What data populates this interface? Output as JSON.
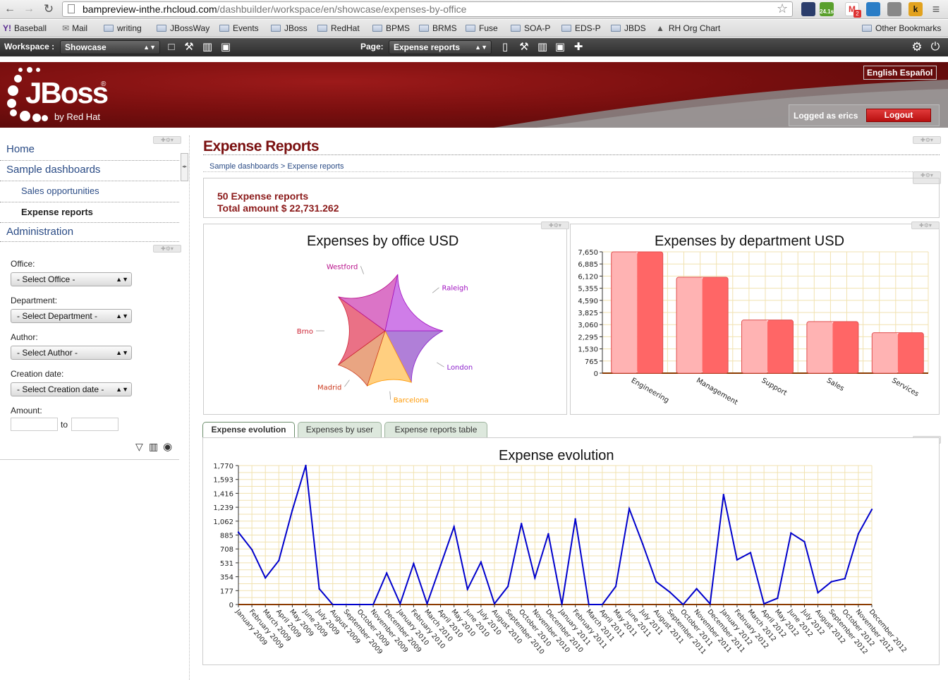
{
  "browser": {
    "url_host": "bampreview-inthe.rhcloud.com",
    "url_path": "/dashbuilder/workspace/en/showcase/expenses-by-office",
    "ext_badges": [
      "24.1s",
      "2"
    ],
    "bookmarks": [
      "Baseball",
      "Mail",
      "writing",
      "JBossWay",
      "Events",
      "JBoss",
      "RedHat",
      "BPMS",
      "BRMS",
      "Fuse",
      "SOA-P",
      "EDS-P",
      "JBDS",
      "RH Org Chart"
    ],
    "other_bookmarks": "Other Bookmarks"
  },
  "workspace_bar": {
    "workspace_label": "Workspace :",
    "workspace_value": "Showcase",
    "page_label": "Page:",
    "page_value": "Expense reports"
  },
  "header": {
    "logo_text": "JBoss",
    "logo_sub": "by Red Hat",
    "lang_english": "English",
    "lang_espanol": "Español",
    "logged_as": "Logged as erics",
    "logout": "Logout"
  },
  "sidebar": {
    "nav": [
      {
        "label": "Home",
        "level": 1
      },
      {
        "label": "Sample dashboards",
        "level": 1
      },
      {
        "label": "Sales opportunities",
        "level": 2
      },
      {
        "label": "Expense reports",
        "level": 2,
        "active": true
      },
      {
        "label": "Administration",
        "level": 1
      }
    ],
    "filters": {
      "office_label": "Office:",
      "office_value": "- Select Office -",
      "department_label": "Department:",
      "department_value": "- Select Department -",
      "author_label": "Author:",
      "author_value": "- Select Author -",
      "date_label": "Creation date:",
      "date_value": "- Select Creation date -",
      "amount_label": "Amount:",
      "amount_to": "to"
    }
  },
  "main": {
    "title": "Expense Reports",
    "breadcrumb": "Sample dashboards > Expense reports",
    "summary_count": "50 Expense reports",
    "summary_total": "Total amount $ 22,731.262",
    "tabs": [
      "Expense evolution",
      "Expenses by user",
      "Expense reports table"
    ],
    "active_tab": 0
  },
  "colors": {
    "brand_red": "#7a1010",
    "link_blue": "#2a4b85",
    "line_blue": "#0000cc",
    "bar_red": "#ff6666"
  },
  "chart_data": [
    {
      "type": "pie",
      "title": "Expenses by office USD",
      "categories": [
        "London",
        "Barcelona",
        "Madrid",
        "Brno",
        "Westford",
        "Raleigh"
      ],
      "values": [
        17.5,
        12.5,
        10.0,
        20.0,
        18.5,
        21.5
      ],
      "colors": [
        "#b07fd8",
        "#ffcf80",
        "#e9a582",
        "#ea7186",
        "#db74c7",
        "#cf7de8"
      ],
      "label_colors": [
        "#8b1fcc",
        "#ff9800",
        "#cc3b1f",
        "#cc2233",
        "#b8108a",
        "#a010c0"
      ]
    },
    {
      "type": "bar",
      "title": "Expenses by department USD",
      "categories": [
        "Engineering",
        "Management",
        "Support",
        "Sales",
        "Services"
      ],
      "values": [
        7650,
        6050,
        3350,
        3250,
        2550
      ],
      "ylim": [
        0,
        7650
      ],
      "yticks": [
        "0",
        "765",
        "1,530",
        "2,295",
        "3,060",
        "3,825",
        "4,590",
        "5,355",
        "6,120",
        "6,885",
        "7,650"
      ],
      "grid": true
    },
    {
      "type": "line",
      "title": "Expense evolution",
      "x": [
        "January 2009",
        "February 2009",
        "March 2009",
        "April 2009",
        "May 2009",
        "June 2009",
        "July 2009",
        "August 2009",
        "September 2009",
        "October 2009",
        "November 2009",
        "December 2009",
        "January 2010",
        "February 2010",
        "March 2010",
        "April 2010",
        "May 2010",
        "June 2010",
        "July 2010",
        "August 2010",
        "September 2010",
        "October 2010",
        "November 2010",
        "December 2010",
        "January 2011",
        "February 2011",
        "March 2011",
        "April 2011",
        "May 2011",
        "June 2011",
        "July 2011",
        "August 2011",
        "September 2011",
        "October 2011",
        "November 2011",
        "December 2011",
        "January 2012",
        "February 2012",
        "March 2012",
        "April 2012",
        "May 2012",
        "June 2012",
        "July 2012",
        "August 2012",
        "September 2012",
        "October 2012",
        "November 2012",
        "December 2012"
      ],
      "values": [
        920,
        700,
        340,
        560,
        1200,
        1770,
        200,
        0,
        0,
        0,
        0,
        400,
        10,
        520,
        10,
        500,
        990,
        195,
        540,
        10,
        230,
        1030,
        340,
        900,
        0,
        1090,
        0,
        0,
        230,
        1220,
        770,
        290,
        160,
        0,
        200,
        10,
        1400,
        570,
        660,
        10,
        80,
        910,
        800,
        150,
        290,
        330,
        900,
        1210
      ],
      "ylim": [
        0,
        1770
      ],
      "yticks": [
        "0",
        "177",
        "354",
        "531",
        "708",
        "885",
        "1,062",
        "1,239",
        "1,416",
        "1,593",
        "1,770"
      ],
      "grid": true
    }
  ]
}
